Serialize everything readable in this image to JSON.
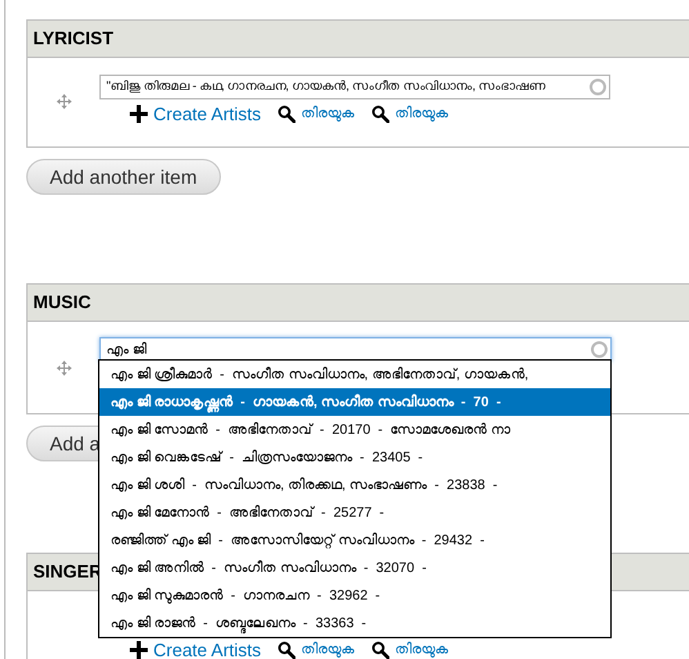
{
  "lyricist": {
    "title": "LYRICIST",
    "value": "\"ബിജു തിരുമല - കഥ, ഗാനരചന, ഗായകൻ, സംഗീത സംവിധാനം, സംഭാഷണ",
    "links": [
      {
        "kind": "create",
        "label": "Create Artists"
      },
      {
        "kind": "search",
        "label": "തിരയുക"
      },
      {
        "kind": "search",
        "label": "തിരയുക"
      }
    ],
    "add_button": "Add another item"
  },
  "music": {
    "title": "MUSIC",
    "value": "എം ജി",
    "add_button": "Add a",
    "suggestions": [
      {
        "label": "എം ജി ശ്രീകുമാർ  -  സംഗീത സംവിധാനം, അഭിനേതാവ്, ഗായകൻ,",
        "selected": false
      },
      {
        "label": "എം ജി രാധാകൃഷ്ണൻ  -  ഗായകൻ, സംഗീത സംവിധാനം  -  70  -",
        "selected": true
      },
      {
        "label": "എം ജി സോമൻ  -  അഭിനേതാവ്  -  20170  -  സോമശേഖരൻ നാ",
        "selected": false
      },
      {
        "label": "എം ജി വെങ്കടേഷ്  -  ചിത്രസംയോജനം  -  23405  -",
        "selected": false
      },
      {
        "label": "എം ജി ശശി  -  സംവിധാനം, തിരക്കഥ, സംഭാഷണം  -  23838  -",
        "selected": false
      },
      {
        "label": "എം ജി മേനോൻ  -  അഭിനേതാവ്  -  25277  -",
        "selected": false
      },
      {
        "label": "രഞ്ജിത്ത് എം ജി  -  അസോസിയേറ്റ് സംവിധാനം  -  29432  -",
        "selected": false
      },
      {
        "label": "എം ജി അനിൽ  -  സംഗീത സംവിധാനം  -  32070  -",
        "selected": false
      },
      {
        "label": "എം ജി സുകുമാരൻ  -  ഗാനരചന  -  32962  -",
        "selected": false
      },
      {
        "label": "എം ജി രാജൻ  -  ശബ്ദലേഖനം  -  33363  -",
        "selected": false
      }
    ]
  },
  "singer": {
    "title": "SINGER",
    "links": [
      {
        "kind": "create",
        "label": "Create Artists"
      },
      {
        "kind": "search",
        "label": "തിരയുക"
      },
      {
        "kind": "search",
        "label": "തിരയുക"
      }
    ]
  }
}
